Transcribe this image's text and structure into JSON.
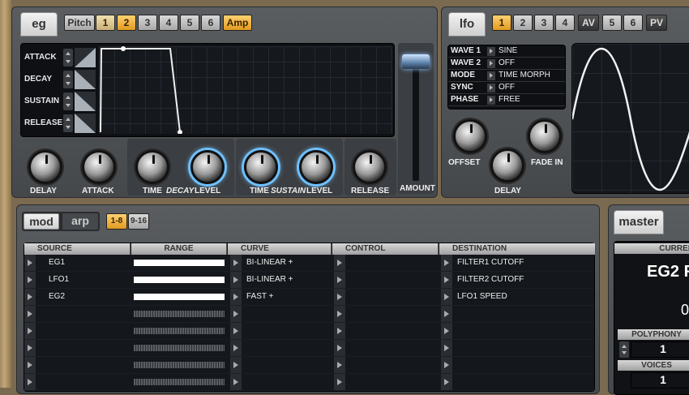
{
  "eg": {
    "title": "eg",
    "pitch_label": "Pitch",
    "numbers": [
      "1",
      "2",
      "3",
      "4",
      "5",
      "6"
    ],
    "amp_label": "Amp",
    "stages": [
      "ATTACK",
      "DECAY",
      "SUSTAIN",
      "RELEASE"
    ],
    "amount_label": "AMOUNT",
    "knobs": {
      "delay": "DELAY",
      "attack": "ATTACK",
      "time1": "TIME",
      "decay": "DECAY",
      "level1": "LEVEL",
      "time2": "TIME",
      "sustain": "SUSTAIN",
      "level2": "LEVEL",
      "release": "RELEASE"
    }
  },
  "lfo": {
    "title": "lfo",
    "numbers": [
      "1",
      "2",
      "3",
      "4"
    ],
    "av_label": "AV",
    "numbers2": [
      "5",
      "6"
    ],
    "pv_label": "PV",
    "params": [
      {
        "key": "WAVE 1",
        "value": "SINE"
      },
      {
        "key": "WAVE 2",
        "value": "OFF"
      },
      {
        "key": "MODE",
        "value": "TIME MORPH"
      },
      {
        "key": "SYNC",
        "value": "OFF"
      },
      {
        "key": "PHASE",
        "value": "FREE"
      }
    ],
    "knobs": {
      "offset": "OFFSET",
      "fade_in": "FADE IN",
      "delay": "DELAY"
    }
  },
  "mod": {
    "tab_mod": "mod",
    "tab_arp": "arp",
    "range1": "1-8",
    "range2": "9-16",
    "headers": {
      "source": "SOURCE",
      "range": "RANGE",
      "curve": "CURVE",
      "control": "CONTROL",
      "destination": "DESTINATION"
    },
    "rows": [
      {
        "source": "EG1",
        "curve": "BI-LINEAR +",
        "destination": "FILTER1 CUTOFF"
      },
      {
        "source": "LFO1",
        "curve": "BI-LINEAR +",
        "destination": "FILTER2 CUTOFF"
      },
      {
        "source": "EG2",
        "curve": "FAST +",
        "destination": "LFO1 SPEED"
      },
      {
        "source": "",
        "curve": "",
        "destination": ""
      },
      {
        "source": "",
        "curve": "",
        "destination": ""
      },
      {
        "source": "",
        "curve": "",
        "destination": ""
      },
      {
        "source": "",
        "curve": "",
        "destination": ""
      },
      {
        "source": "",
        "curve": "",
        "destination": ""
      }
    ]
  },
  "master": {
    "title": "master",
    "current_label": "CURREN",
    "current_value": "EG2 F",
    "big_value": "0",
    "polyphony_label": "POLYPHONY",
    "polyphony_value": "1",
    "voices_label": "VOICES",
    "voices_value": "1"
  }
}
